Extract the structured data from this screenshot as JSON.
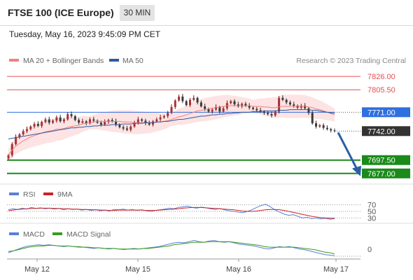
{
  "header": {
    "title": "FTSE 100 (ICE Europe)",
    "timeframe": "30 MIN",
    "datetime": "Tuesday, May 16, 2023 9:45:09 PM CET"
  },
  "legend": {
    "ma20_label": "MA 20 + Bollinger Bands",
    "ma50_label": "MA 50",
    "credit": "Research © 2023 Trading Central",
    "ma20_color": "#f08080",
    "ma50_color": "#2c5aa0"
  },
  "chart_data": [
    {
      "type": "line",
      "panel": "price",
      "x_ticks": [
        "May 12",
        "May 15",
        "May 16",
        "May 17"
      ],
      "ylim": [
        7666,
        7838
      ],
      "levels": [
        {
          "label": "7826.00",
          "value": 7826.0,
          "kind": "resistance",
          "color": "#e05050"
        },
        {
          "label": "7805.50",
          "value": 7805.5,
          "kind": "resistance",
          "color": "#e05050"
        },
        {
          "label": "7771.00",
          "value": 7771.0,
          "kind": "pivot",
          "color": "#2f6fe0"
        },
        {
          "label": "7742.00",
          "value": 7742.0,
          "kind": "last",
          "color": "#333333"
        },
        {
          "label": "7697.50",
          "value": 7697.5,
          "kind": "support",
          "color": "#1a8a1a"
        },
        {
          "label": "7677.00",
          "value": 7677.0,
          "kind": "support",
          "color": "#1a8a1a"
        }
      ],
      "close": [
        7705,
        7722,
        7733,
        7737,
        7742,
        7745,
        7749,
        7753,
        7750,
        7756,
        7760,
        7755,
        7758,
        7763,
        7757,
        7760,
        7768,
        7765,
        7759,
        7755,
        7757,
        7754,
        7760,
        7758,
        7755,
        7752,
        7756,
        7759,
        7757,
        7752,
        7748,
        7746,
        7744,
        7749,
        7755,
        7760,
        7758,
        7754,
        7752,
        7757,
        7760,
        7763,
        7765,
        7770,
        7779,
        7789,
        7795,
        7788,
        7782,
        7790,
        7793,
        7786,
        7780,
        7776,
        7772,
        7775,
        7779,
        7772,
        7777,
        7785,
        7788,
        7783,
        7780,
        7784,
        7781,
        7778,
        7776,
        7774,
        7772,
        7770,
        7768,
        7766,
        7772,
        7793,
        7790,
        7786,
        7783,
        7781,
        7778,
        7781,
        7777,
        7770,
        7754,
        7749,
        7751,
        7747,
        7745,
        7743,
        7742
      ],
      "ma20": [
        7705,
        7713,
        7719,
        7723,
        7727,
        7730,
        7733,
        7735,
        7737,
        7739,
        7741,
        7742,
        7743,
        7745,
        7745,
        7746,
        7748,
        7749,
        7750,
        7751,
        7753,
        7754,
        7755,
        7756,
        7757,
        7757,
        7757,
        7757,
        7757,
        7757,
        7757,
        7756,
        7756,
        7756,
        7755,
        7755,
        7755,
        7755,
        7755,
        7755,
        7756,
        7756,
        7757,
        7758,
        7760,
        7762,
        7764,
        7765,
        7767,
        7769,
        7771,
        7773,
        7774,
        7775,
        7776,
        7777,
        7778,
        7779,
        7780,
        7781,
        7781,
        7781,
        7781,
        7781,
        7781,
        7781,
        7780,
        7780,
        7780,
        7779,
        7779,
        7778,
        7778,
        7779,
        7780,
        7780,
        7780,
        7780,
        7780,
        7780,
        7780,
        7779,
        7778,
        7776,
        7775,
        7773,
        7771,
        7769,
        7767
      ],
      "ma50": [
        7730,
        7731,
        7732,
        7733,
        7734,
        7735,
        7736,
        7737,
        7738,
        7739,
        7740,
        7741,
        7742,
        7743,
        7744,
        7745,
        7746,
        7747,
        7747,
        7748,
        7748,
        7749,
        7749,
        7750,
        7750,
        7751,
        7751,
        7751,
        7752,
        7752,
        7752,
        7753,
        7753,
        7753,
        7754,
        7754,
        7754,
        7755,
        7755,
        7755,
        7756,
        7756,
        7757,
        7757,
        7758,
        7759,
        7760,
        7760,
        7761,
        7762,
        7763,
        7764,
        7765,
        7765,
        7766,
        7767,
        7767,
        7768,
        7768,
        7769,
        7769,
        7770,
        7770,
        7771,
        7771,
        7771,
        7772,
        7772,
        7772,
        7773,
        7773,
        7773,
        7773,
        7774,
        7774,
        7774,
        7775,
        7775,
        7775,
        7775,
        7775,
        7775,
        7774,
        7774,
        7773,
        7772,
        7771,
        7770,
        7769
      ]
    },
    {
      "type": "line",
      "panel": "rsi",
      "series": [
        {
          "name": "RSI",
          "color": "#5b7fd6"
        },
        {
          "name": "9MA",
          "color": "#cc2222"
        }
      ],
      "levels": [
        {
          "label": "70",
          "value": 70
        },
        {
          "label": "50",
          "value": 50
        },
        {
          "label": "30",
          "value": 30
        }
      ],
      "ylim": [
        20,
        80
      ],
      "rsi": [
        55,
        58,
        56,
        60,
        57,
        62,
        59,
        61,
        58,
        60,
        57,
        59,
        55,
        58,
        56,
        57,
        54,
        56,
        53,
        55,
        52,
        54,
        51,
        56,
        55,
        57,
        54,
        56,
        53,
        55,
        52,
        50,
        53,
        55,
        57,
        60,
        58,
        62,
        64,
        66,
        62,
        60,
        63,
        61,
        58,
        56,
        59,
        55,
        52,
        50,
        48,
        46,
        50,
        55,
        62,
        68,
        72,
        64,
        55,
        48,
        42,
        38,
        40,
        35,
        30,
        32,
        28,
        30,
        27,
        29,
        26,
        28
      ],
      "ma9": [
        52,
        54,
        56,
        57,
        58,
        59,
        59,
        60,
        60,
        60,
        59,
        59,
        58,
        58,
        57,
        57,
        56,
        56,
        55,
        55,
        54,
        54,
        53,
        53,
        54,
        54,
        54,
        54,
        54,
        54,
        53,
        53,
        53,
        54,
        55,
        56,
        57,
        58,
        60,
        61,
        62,
        62,
        62,
        61,
        60,
        59,
        58,
        57,
        56,
        55,
        53,
        51,
        50,
        50,
        51,
        53,
        55,
        56,
        56,
        55,
        53,
        50,
        47,
        44,
        41,
        38,
        35,
        33,
        31,
        30,
        29,
        29
      ]
    },
    {
      "type": "line",
      "panel": "macd",
      "series": [
        {
          "name": "MACD",
          "color": "#5b7fd6"
        },
        {
          "name": "MACD Signal",
          "color": "#3a9a20"
        }
      ],
      "ytick": "0",
      "macd": [
        -8,
        -5,
        -2,
        1,
        3,
        4,
        5,
        4,
        5,
        4,
        3,
        2,
        3,
        2,
        1,
        1,
        0,
        -1,
        0,
        -1,
        -2,
        -1,
        -2,
        -3,
        -2,
        -1,
        -2,
        -1,
        0,
        1,
        2,
        4,
        6,
        8,
        9,
        8,
        10,
        12,
        10,
        9,
        11,
        12,
        10,
        9,
        10,
        8,
        6,
        5,
        4,
        3,
        1,
        -1,
        -2,
        0,
        2,
        1,
        2,
        0,
        -2,
        -3,
        -5,
        -7,
        -9,
        -11,
        -12,
        -13
      ],
      "signal": [
        -6,
        -5,
        -3,
        -1,
        1,
        2,
        3,
        3,
        4,
        4,
        3,
        3,
        3,
        2,
        2,
        1,
        1,
        0,
        0,
        -1,
        -1,
        -1,
        -2,
        -2,
        -2,
        -2,
        -2,
        -1,
        -1,
        0,
        1,
        2,
        3,
        5,
        6,
        7,
        8,
        9,
        9,
        9,
        10,
        10,
        10,
        10,
        10,
        9,
        8,
        7,
        6,
        5,
        4,
        2,
        1,
        1,
        1,
        1,
        1,
        1,
        0,
        -1,
        -2,
        -3,
        -5,
        -7,
        -8,
        -10
      ]
    }
  ],
  "rsi_legend": {
    "rsi_label": "RSI",
    "ma_label": "9MA"
  },
  "macd_legend": {
    "macd_label": "MACD",
    "signal_label": "MACD Signal"
  }
}
